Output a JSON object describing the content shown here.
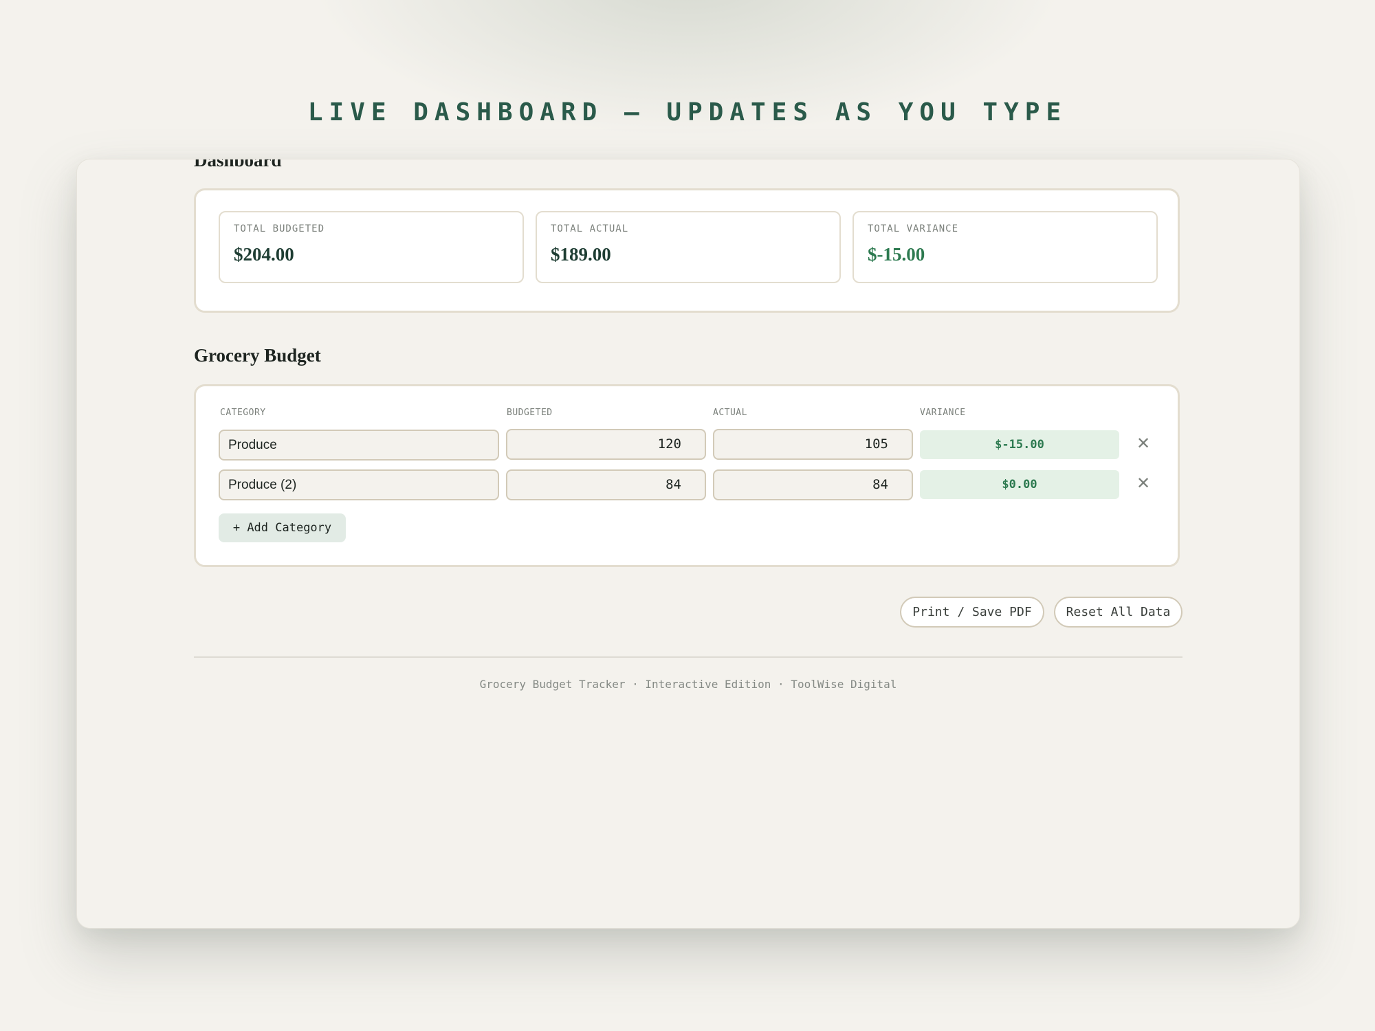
{
  "banner": {
    "text": "LIVE DASHBOARD — UPDATES AS YOU TYPE"
  },
  "dashboard": {
    "heading": "Dashboard",
    "stats": [
      {
        "label": "TOTAL BUDGETED",
        "value": "$204.00"
      },
      {
        "label": "TOTAL ACTUAL",
        "value": "$189.00"
      },
      {
        "label": "TOTAL VARIANCE",
        "value": "$-15.00"
      }
    ]
  },
  "budget": {
    "heading": "Grocery Budget",
    "columns": [
      "CATEGORY",
      "BUDGETED",
      "ACTUAL",
      "VARIANCE"
    ],
    "rows": [
      {
        "category": "Produce",
        "budgeted": "120",
        "actual": "105",
        "variance": "$-15.00"
      },
      {
        "category": "Produce (2)",
        "budgeted": "84",
        "actual": "84",
        "variance": "$0.00"
      }
    ],
    "remove_symbol": "✕",
    "add_button": "+ Add Category"
  },
  "actions": {
    "print": "Print / Save PDF",
    "reset": "Reset All Data"
  },
  "footer": {
    "text": "Grocery Budget Tracker · Interactive Edition · ToolWise Digital"
  },
  "colors": {
    "accent": "#2a5a4a",
    "positive": "#2d7a50",
    "variance_bg": "#e4f1e6",
    "page_bg": "#f4f2ed"
  },
  "icons": {
    "remove": "close-icon"
  }
}
